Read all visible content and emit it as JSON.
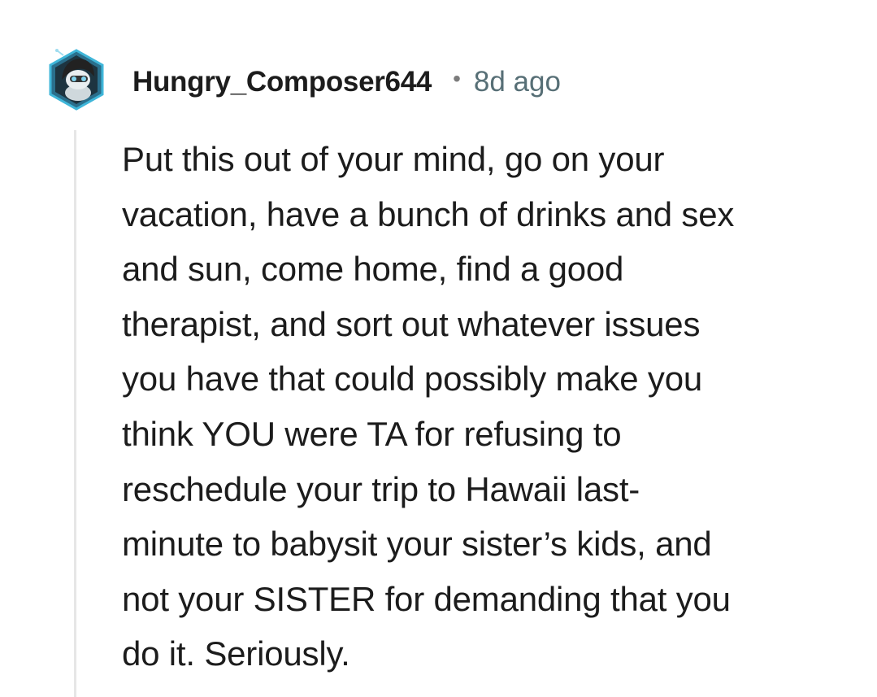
{
  "comment": {
    "username": "Hungry_Composer644",
    "separator": "•",
    "time_ago": "8d ago",
    "body": "Put this out of your mind, go on your\nvacation, have a bunch of drinks and sex\nand sun, come home, find a good\ntherapist, and sort out whatever issues\nyou have that could possibly make you\nthink YOU were TA for refusing to\nreschedule your trip to Hawaii last-\nminute to babysit your sister’s kids, and\nnot your SISTER for demanding that you\ndo it. Seriously."
  },
  "colors": {
    "text": "#1c1c1c",
    "meta": "#576f76",
    "thread_line": "#e6e6e6",
    "avatar_accent": "#3fb6d9"
  },
  "icons": {
    "avatar": "snoo-avatar-icon"
  }
}
